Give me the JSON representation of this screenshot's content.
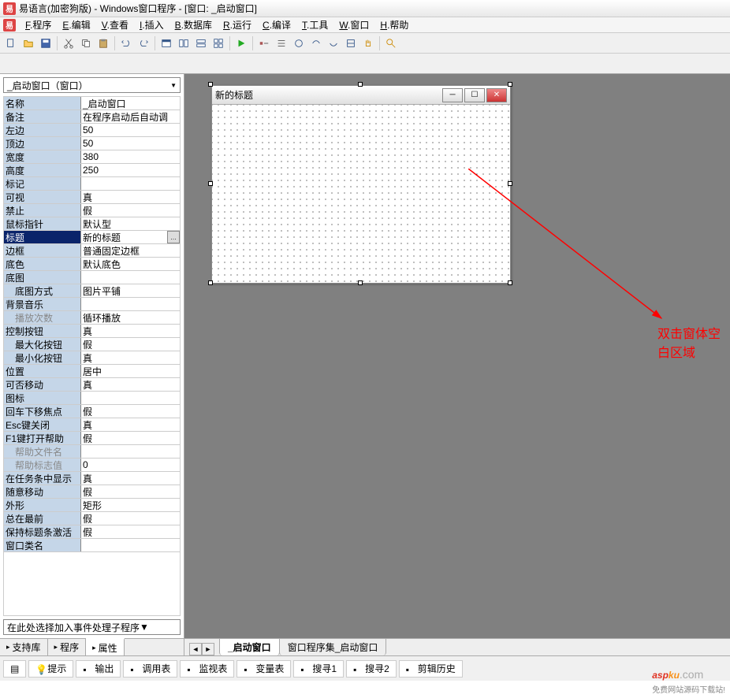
{
  "title": "易语言(加密狗版) - Windows窗口程序 - [窗口: _启动窗口]",
  "menu": [
    "F.程序",
    "E.编辑",
    "V.查看",
    "I.插入",
    "B.数据库",
    "R.运行",
    "C.编译",
    "T.工具",
    "W.窗口",
    "H.帮助"
  ],
  "object_selector": "_启动窗口（窗口）",
  "event_selector": "在此处选择加入事件处理子程序",
  "properties": [
    {
      "label": "名称",
      "value": "_启动窗口"
    },
    {
      "label": "备注",
      "value": "在程序启动后自动调"
    },
    {
      "label": "左边",
      "value": "50"
    },
    {
      "label": "顶边",
      "value": "50"
    },
    {
      "label": "宽度",
      "value": "380"
    },
    {
      "label": "高度",
      "value": "250"
    },
    {
      "label": "标记",
      "value": ""
    },
    {
      "label": "可视",
      "value": "真"
    },
    {
      "label": "禁止",
      "value": "假"
    },
    {
      "label": "鼠标指针",
      "value": "默认型"
    },
    {
      "label": "标题",
      "value": "新的标题",
      "selected": true,
      "more": true
    },
    {
      "label": "边框",
      "value": "普通固定边框"
    },
    {
      "label": "底色",
      "value": "默认底色"
    },
    {
      "label": "底图",
      "value": ""
    },
    {
      "label": "底图方式",
      "value": "图片平铺",
      "indent": true
    },
    {
      "label": "背景音乐",
      "value": ""
    },
    {
      "label": "播放次数",
      "value": "循环播放",
      "indent": true,
      "disabled": true
    },
    {
      "label": "控制按钮",
      "value": "真"
    },
    {
      "label": "最大化按钮",
      "value": "假",
      "indent": true
    },
    {
      "label": "最小化按钮",
      "value": "真",
      "indent": true
    },
    {
      "label": "位置",
      "value": "居中"
    },
    {
      "label": "可否移动",
      "value": "真"
    },
    {
      "label": "图标",
      "value": ""
    },
    {
      "label": "回车下移焦点",
      "value": "假"
    },
    {
      "label": "Esc键关闭",
      "value": "真"
    },
    {
      "label": "F1键打开帮助",
      "value": "假"
    },
    {
      "label": "帮助文件名",
      "value": "",
      "indent": true,
      "disabled": true
    },
    {
      "label": "帮助标志值",
      "value": "0",
      "indent": true,
      "disabled": true
    },
    {
      "label": "在任务条中显示",
      "value": "真"
    },
    {
      "label": "随意移动",
      "value": "假"
    },
    {
      "label": "外形",
      "value": "矩形"
    },
    {
      "label": "总在最前",
      "value": "假"
    },
    {
      "label": "保持标题条激活",
      "value": "假"
    },
    {
      "label": "窗口类名",
      "value": ""
    }
  ],
  "left_tabs": [
    {
      "label": "支持库",
      "icon": "book"
    },
    {
      "label": "程序",
      "icon": "code"
    },
    {
      "label": "属性",
      "icon": "props",
      "active": true
    }
  ],
  "canvas": {
    "form_title": "新的标题",
    "annotation": "双击窗体空白区域"
  },
  "bottom_tabs": [
    {
      "label": "_启动窗口",
      "active": true
    },
    {
      "label": "窗口程序集_启动窗口"
    }
  ],
  "status_items": [
    "提示",
    "输出",
    "调用表",
    "监视表",
    "变量表",
    "搜寻1",
    "搜寻2",
    "剪辑历史"
  ],
  "watermark": {
    "brand1": "asp",
    "brand2": "ku",
    "suffix": ".com",
    "sub": "免费网站源码下载站!"
  }
}
